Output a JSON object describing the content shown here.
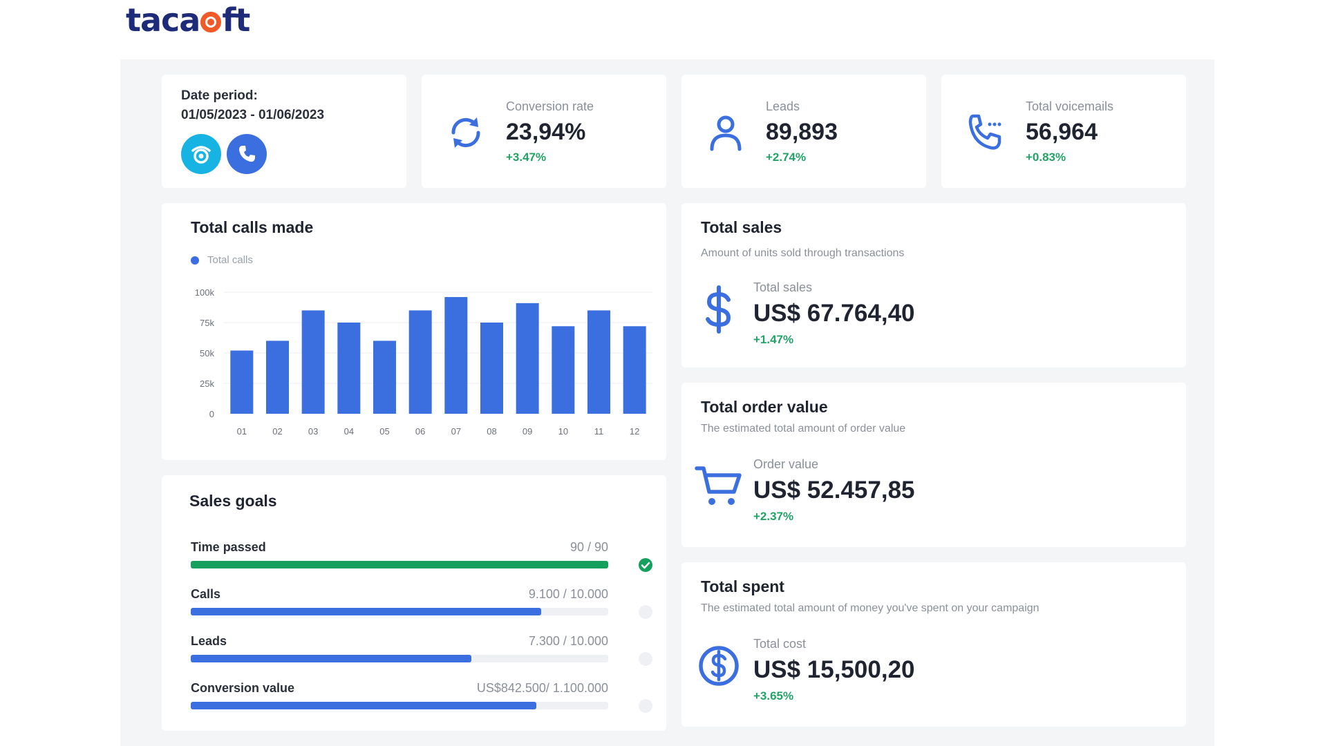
{
  "brand": {
    "logo_pre": "taca",
    "logo_post": "ft"
  },
  "colors": {
    "accent": "#3b6fe0",
    "success": "#21a366",
    "navy": "#1e2b78",
    "orange": "#f05a28"
  },
  "date_period": {
    "label": "Date period:",
    "value": "01/05/2023 - 01/06/2023",
    "buttons": [
      {
        "icon": "voicemail-icon"
      },
      {
        "icon": "phone-icon"
      }
    ]
  },
  "stats": [
    {
      "label": "Conversion rate",
      "value": "23,94%",
      "delta": "+3.47%",
      "icon": "refresh-icon"
    },
    {
      "label": "Leads",
      "value": "89,893",
      "delta": "+2.74%",
      "icon": "user-icon"
    },
    {
      "label": "Total voicemails",
      "value": "56,964",
      "delta": "+0.83%",
      "icon": "phone-call-icon"
    }
  ],
  "calls_chart": {
    "title": "Total calls made",
    "legend": "Total calls"
  },
  "chart_data": {
    "type": "bar",
    "categories": [
      "01",
      "02",
      "03",
      "04",
      "05",
      "06",
      "07",
      "08",
      "09",
      "10",
      "11",
      "12"
    ],
    "series": [
      {
        "name": "Total calls",
        "values": [
          52000,
          60000,
          85000,
          75000,
          60000,
          85000,
          96000,
          75000,
          91000,
          72000,
          85000,
          72000
        ]
      }
    ],
    "y_ticks": [
      "0",
      "25k",
      "50k",
      "75k",
      "100k"
    ],
    "ylim": [
      0,
      100000
    ],
    "grid": true,
    "legend_position": "top-left",
    "color": "#3b6fe0"
  },
  "sales_goals": {
    "title": "Sales goals",
    "goals": [
      {
        "name": "Time passed",
        "value": "90 / 90",
        "progress": 1.0,
        "color": "#16a05d",
        "done": true
      },
      {
        "name": "Calls",
        "value": "9.100 / 10.000",
        "progress": 0.84,
        "color": "#3b6fe0",
        "done": false
      },
      {
        "name": "Leads",
        "value": "7.300 / 10.000",
        "progress": 0.672,
        "color": "#3b6fe0",
        "done": false
      },
      {
        "name": "Conversion value",
        "value": "US$842.500/ 1.100.000",
        "progress": 0.827,
        "color": "#3b6fe0",
        "done": false
      }
    ]
  },
  "total_sales": {
    "title": "Total sales",
    "subtitle": "Amount of units sold through transactions",
    "label": "Total sales",
    "value": "US$ 67.764,40",
    "delta": "+1.47%",
    "icon": "dollar-icon"
  },
  "total_order": {
    "title": "Total order value",
    "subtitle": "The estimated total amount of order value",
    "label": "Order value",
    "value": "US$ 52.457,85",
    "delta": "+2.37%",
    "icon": "cart-icon"
  },
  "total_spent": {
    "title": "Total spent",
    "subtitle": "The estimated total amount of money you've spent on your campaign",
    "label": "Total cost",
    "value": "US$ 15,500,20",
    "delta": "+3.65%",
    "icon": "dollar-circle-icon"
  }
}
